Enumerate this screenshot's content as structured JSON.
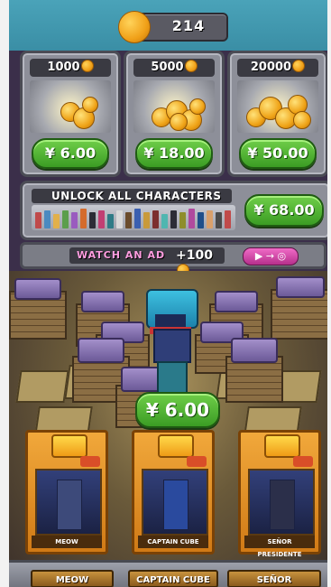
{
  "header": {
    "coin_total": "214",
    "coin_icon": "coin-icon"
  },
  "packs": [
    {
      "amount": "1000",
      "price": "¥ 6.00"
    },
    {
      "amount": "5000",
      "price": "¥ 18.00"
    },
    {
      "amount": "20000",
      "price": "¥ 50.00"
    }
  ],
  "unlock": {
    "title": "UNLOCK ALL CHARACTERS",
    "price": "¥ 68.00"
  },
  "ad": {
    "text": "WATCH AN AD",
    "bonus": "+100",
    "button_icon": "play-arrow-icon"
  },
  "scene": {
    "price": "¥ 6.00"
  },
  "cards": [
    {
      "name": "MEOW"
    },
    {
      "name": "CAPTAIN CUBE"
    },
    {
      "name": "SEÑOR PRESIDENTE"
    }
  ],
  "shelf": {
    "labels": [
      "MEOW",
      "CAPTAIN CUBE",
      "SEÑOR PRESIDENTE"
    ]
  },
  "colors": {
    "price_button": "#3b9c24",
    "panel": "#8d8f99",
    "ad_button": "#e05bb8"
  }
}
